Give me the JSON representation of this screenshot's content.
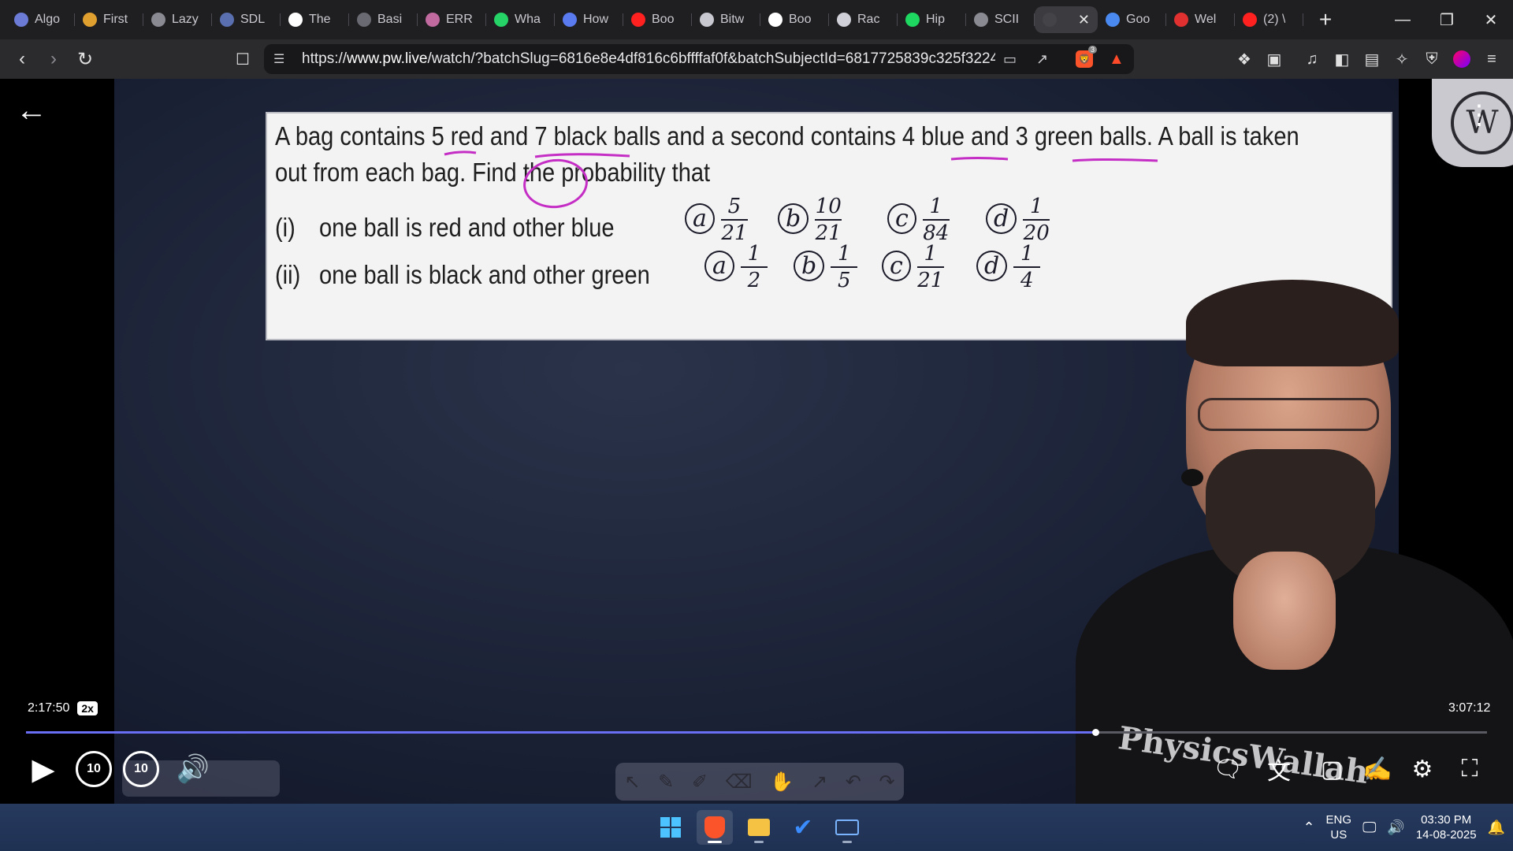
{
  "browser": {
    "tabs": [
      {
        "label": "Algo",
        "icon": "chat-icon",
        "color": "#6b7bd6"
      },
      {
        "label": "First",
        "icon": "lightning-icon",
        "color": "#e0a030"
      },
      {
        "label": "Lazy",
        "icon": "globe-icon",
        "color": "#8a8a92"
      },
      {
        "label": "SDL",
        "icon": "sdl-icon",
        "color": "#5a6fb0"
      },
      {
        "label": "The",
        "icon": "w3-icon",
        "color": "#ffffff"
      },
      {
        "label": "Basi",
        "icon": "doc-icon",
        "color": "#6a6a72"
      },
      {
        "label": "ERR",
        "icon": "brain-icon",
        "color": "#c06aa0"
      },
      {
        "label": "Wha",
        "icon": "whatsapp-icon",
        "color": "#25d366"
      },
      {
        "label": "How",
        "icon": "bookmark-icon",
        "color": "#5a7bf0"
      },
      {
        "label": "Boo",
        "icon": "youtube-icon",
        "color": "#ff2020"
      },
      {
        "label": "Bitw",
        "icon": "bitwarden-icon",
        "color": "#c8c8d0"
      },
      {
        "label": "Boo",
        "icon": "google-icon",
        "color": "#ffffff"
      },
      {
        "label": "Rac",
        "icon": "openai-icon",
        "color": "#d0d0d8"
      },
      {
        "label": "Hip",
        "icon": "spotify-icon",
        "color": "#1ed760"
      },
      {
        "label": "SCII",
        "icon": "globe-icon",
        "color": "#8a8a92"
      },
      {
        "label": "",
        "icon": "pw-icon",
        "color": "#444448",
        "active": true
      },
      {
        "label": "Goo",
        "icon": "gemini-icon",
        "color": "#4a8af0"
      },
      {
        "label": "Wel",
        "icon": "opera-icon",
        "color": "#e03030"
      },
      {
        "label": "(2) \\",
        "icon": "youtube-icon",
        "color": "#ff2020"
      }
    ],
    "new_tab": "+",
    "window_controls": {
      "minimize": "—",
      "restore": "❐",
      "close": "✕"
    },
    "url_prefix": "https://",
    "url_domain": "www.pw.live",
    "url_rest": "/watch/?batchSlug=6816e8e4df816c6bffffaf0f&batchSubjectId=6817725839c325f3224e28d...",
    "shield_count": "3"
  },
  "video": {
    "question_line1": "A bag contains 5 red and 7 black balls and a second contains 4 blue and 3 green balls. A ball is taken",
    "question_line2": "out from each bag. Find the probability that",
    "part1_label": "(i)",
    "part1_text": "one ball is red and other blue",
    "part2_label": "(ii)",
    "part2_text": "one ball is black and other green",
    "options_part1": [
      {
        "letter": "a",
        "num": "5",
        "den": "21"
      },
      {
        "letter": "b",
        "num": "10",
        "den": "21"
      },
      {
        "letter": "c",
        "num": "1",
        "den": "84"
      },
      {
        "letter": "d",
        "num": "1",
        "den": "20"
      }
    ],
    "options_part2": [
      {
        "letter": "a",
        "num": "1",
        "den": "2"
      },
      {
        "letter": "b",
        "num": "1",
        "den": "5"
      },
      {
        "letter": "c",
        "num": "1",
        "den": "21"
      },
      {
        "letter": "d",
        "num": "1",
        "den": "4"
      }
    ],
    "watermark": "PhysicsWallah",
    "logo_text": "W"
  },
  "player": {
    "current_time": "2:17:50",
    "speed": "2x",
    "total_time": "3:07:12",
    "progress_fraction": 0.732,
    "rewind_label": "10",
    "forward_label": "10"
  },
  "taskbar": {
    "lang_top": "ENG",
    "lang_bottom": "US",
    "time": "03:30 PM",
    "date": "14-08-2025"
  }
}
